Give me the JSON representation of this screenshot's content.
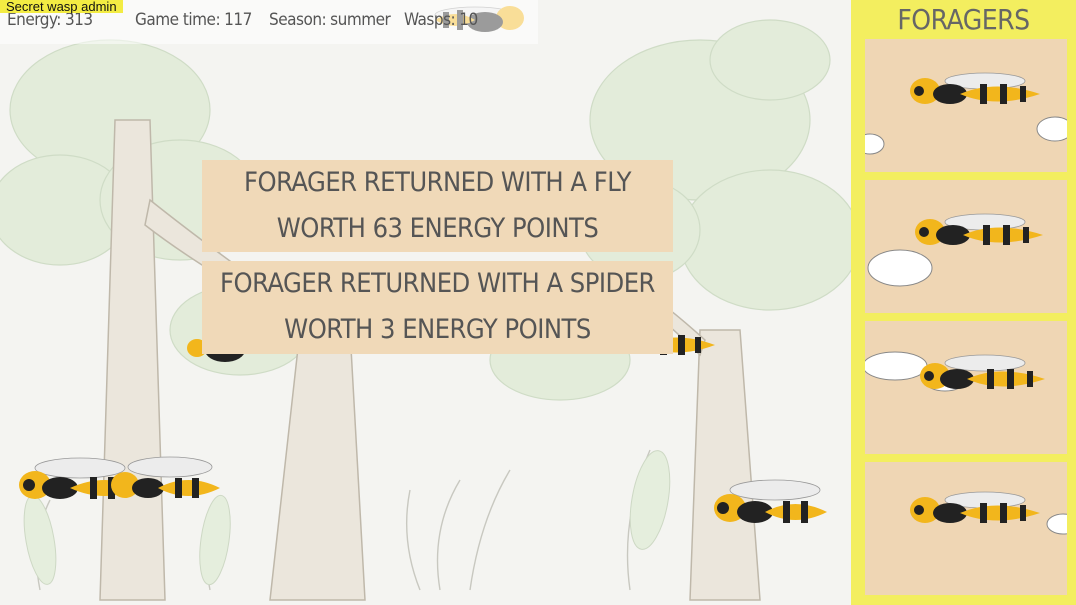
{
  "admin": {
    "label": "Secret wasp admin"
  },
  "stats": {
    "energy_label": "Energy:",
    "energy_value": "313",
    "time_label": "Game time:",
    "time_value": "117",
    "season_label": "Season:",
    "season_value": "summer",
    "wasps_label": "Wasps:",
    "wasps_value": "10"
  },
  "messages": [
    {
      "text": "Forager returned with a fly worth 63 energy points"
    },
    {
      "text": "Forager returned with a spider worth 3 energy points"
    }
  ],
  "panel": {
    "title": "FORAGERS",
    "cards": [
      {
        "name": "forager-1",
        "icon": "wasp-icon"
      },
      {
        "name": "forager-2",
        "icon": "wasp-icon"
      },
      {
        "name": "forager-3",
        "icon": "wasp-icon"
      },
      {
        "name": "forager-4",
        "icon": "wasp-icon"
      }
    ]
  },
  "colors": {
    "panel": "#f3ee5f",
    "card": "#efd6b4",
    "message": "#f0d9b8",
    "wasp_yellow": "#f2b61c",
    "wasp_black": "#222222",
    "tree_foliage": "#dfead6"
  }
}
